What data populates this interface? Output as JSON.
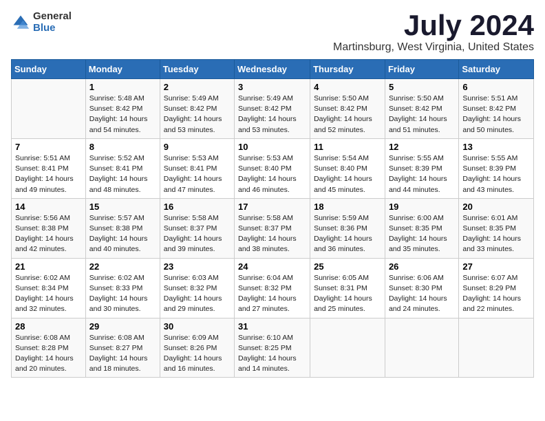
{
  "logo": {
    "general": "General",
    "blue": "Blue"
  },
  "title": "July 2024",
  "location": "Martinsburg, West Virginia, United States",
  "days_header": [
    "Sunday",
    "Monday",
    "Tuesday",
    "Wednesday",
    "Thursday",
    "Friday",
    "Saturday"
  ],
  "weeks": [
    [
      {
        "day": "",
        "info": ""
      },
      {
        "day": "1",
        "info": "Sunrise: 5:48 AM\nSunset: 8:42 PM\nDaylight: 14 hours\nand 54 minutes."
      },
      {
        "day": "2",
        "info": "Sunrise: 5:49 AM\nSunset: 8:42 PM\nDaylight: 14 hours\nand 53 minutes."
      },
      {
        "day": "3",
        "info": "Sunrise: 5:49 AM\nSunset: 8:42 PM\nDaylight: 14 hours\nand 53 minutes."
      },
      {
        "day": "4",
        "info": "Sunrise: 5:50 AM\nSunset: 8:42 PM\nDaylight: 14 hours\nand 52 minutes."
      },
      {
        "day": "5",
        "info": "Sunrise: 5:50 AM\nSunset: 8:42 PM\nDaylight: 14 hours\nand 51 minutes."
      },
      {
        "day": "6",
        "info": "Sunrise: 5:51 AM\nSunset: 8:42 PM\nDaylight: 14 hours\nand 50 minutes."
      }
    ],
    [
      {
        "day": "7",
        "info": "Sunrise: 5:51 AM\nSunset: 8:41 PM\nDaylight: 14 hours\nand 49 minutes."
      },
      {
        "day": "8",
        "info": "Sunrise: 5:52 AM\nSunset: 8:41 PM\nDaylight: 14 hours\nand 48 minutes."
      },
      {
        "day": "9",
        "info": "Sunrise: 5:53 AM\nSunset: 8:41 PM\nDaylight: 14 hours\nand 47 minutes."
      },
      {
        "day": "10",
        "info": "Sunrise: 5:53 AM\nSunset: 8:40 PM\nDaylight: 14 hours\nand 46 minutes."
      },
      {
        "day": "11",
        "info": "Sunrise: 5:54 AM\nSunset: 8:40 PM\nDaylight: 14 hours\nand 45 minutes."
      },
      {
        "day": "12",
        "info": "Sunrise: 5:55 AM\nSunset: 8:39 PM\nDaylight: 14 hours\nand 44 minutes."
      },
      {
        "day": "13",
        "info": "Sunrise: 5:55 AM\nSunset: 8:39 PM\nDaylight: 14 hours\nand 43 minutes."
      }
    ],
    [
      {
        "day": "14",
        "info": "Sunrise: 5:56 AM\nSunset: 8:38 PM\nDaylight: 14 hours\nand 42 minutes."
      },
      {
        "day": "15",
        "info": "Sunrise: 5:57 AM\nSunset: 8:38 PM\nDaylight: 14 hours\nand 40 minutes."
      },
      {
        "day": "16",
        "info": "Sunrise: 5:58 AM\nSunset: 8:37 PM\nDaylight: 14 hours\nand 39 minutes."
      },
      {
        "day": "17",
        "info": "Sunrise: 5:58 AM\nSunset: 8:37 PM\nDaylight: 14 hours\nand 38 minutes."
      },
      {
        "day": "18",
        "info": "Sunrise: 5:59 AM\nSunset: 8:36 PM\nDaylight: 14 hours\nand 36 minutes."
      },
      {
        "day": "19",
        "info": "Sunrise: 6:00 AM\nSunset: 8:35 PM\nDaylight: 14 hours\nand 35 minutes."
      },
      {
        "day": "20",
        "info": "Sunrise: 6:01 AM\nSunset: 8:35 PM\nDaylight: 14 hours\nand 33 minutes."
      }
    ],
    [
      {
        "day": "21",
        "info": "Sunrise: 6:02 AM\nSunset: 8:34 PM\nDaylight: 14 hours\nand 32 minutes."
      },
      {
        "day": "22",
        "info": "Sunrise: 6:02 AM\nSunset: 8:33 PM\nDaylight: 14 hours\nand 30 minutes."
      },
      {
        "day": "23",
        "info": "Sunrise: 6:03 AM\nSunset: 8:32 PM\nDaylight: 14 hours\nand 29 minutes."
      },
      {
        "day": "24",
        "info": "Sunrise: 6:04 AM\nSunset: 8:32 PM\nDaylight: 14 hours\nand 27 minutes."
      },
      {
        "day": "25",
        "info": "Sunrise: 6:05 AM\nSunset: 8:31 PM\nDaylight: 14 hours\nand 25 minutes."
      },
      {
        "day": "26",
        "info": "Sunrise: 6:06 AM\nSunset: 8:30 PM\nDaylight: 14 hours\nand 24 minutes."
      },
      {
        "day": "27",
        "info": "Sunrise: 6:07 AM\nSunset: 8:29 PM\nDaylight: 14 hours\nand 22 minutes."
      }
    ],
    [
      {
        "day": "28",
        "info": "Sunrise: 6:08 AM\nSunset: 8:28 PM\nDaylight: 14 hours\nand 20 minutes."
      },
      {
        "day": "29",
        "info": "Sunrise: 6:08 AM\nSunset: 8:27 PM\nDaylight: 14 hours\nand 18 minutes."
      },
      {
        "day": "30",
        "info": "Sunrise: 6:09 AM\nSunset: 8:26 PM\nDaylight: 14 hours\nand 16 minutes."
      },
      {
        "day": "31",
        "info": "Sunrise: 6:10 AM\nSunset: 8:25 PM\nDaylight: 14 hours\nand 14 minutes."
      },
      {
        "day": "",
        "info": ""
      },
      {
        "day": "",
        "info": ""
      },
      {
        "day": "",
        "info": ""
      }
    ]
  ]
}
